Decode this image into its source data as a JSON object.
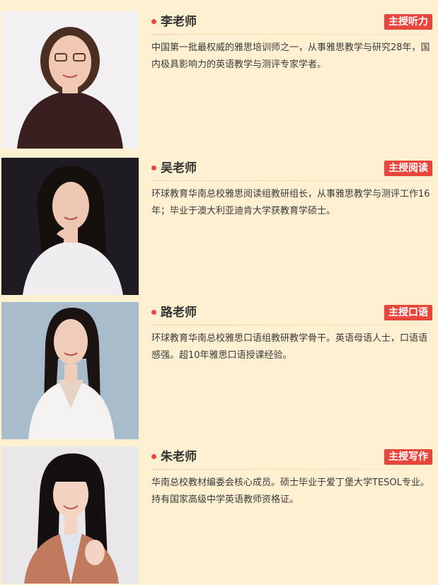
{
  "teachers": [
    {
      "name": "李老师",
      "badge": "主授听力",
      "desc": "中国第一批最权威的雅思培训师之一，从事雅思教学与研究28年，国内极具影响力的英语教学与测评专家学者。",
      "photo_alt": "李老师照片",
      "colors": {
        "bg": "#f3f0f4",
        "hair": "#4a2f22",
        "skin": "#f1c9b2",
        "clothes": "#3a1f20"
      }
    },
    {
      "name": "吴老师",
      "badge": "主授阅读",
      "desc": "环球教育华南总校雅思阅读组教研组长，从事雅思教学与测评工作16年；毕业于澳大利亚迪肯大学获教育学硕士。",
      "photo_alt": "吴老师照片",
      "colors": {
        "bg": "#1e1c22",
        "hair": "#15100e",
        "skin": "#eec7b2",
        "clothes": "#efedf0"
      }
    },
    {
      "name": "路老师",
      "badge": "主授口语",
      "desc": "环球教育华南总校雅思口语组教研教学骨干。英语母语人士，口语语感强。超10年雅思口语授课经验。",
      "photo_alt": "路老师照片",
      "colors": {
        "bg": "#a9bccb",
        "hair": "#1a1311",
        "skin": "#f0cdb8",
        "clothes": "#f4f3f1"
      }
    },
    {
      "name": "朱老师",
      "badge": "主授写作",
      "desc": "华南总校教材编委会核心成员。硕士毕业于爱丁堡大学TESOL专业。持有国家高级中学英语教师资格证。",
      "photo_alt": "朱老师照片",
      "colors": {
        "bg": "#e9e7e9",
        "hair": "#141012",
        "skin": "#f4d3c3",
        "clothes": "#c07a5e"
      }
    }
  ]
}
